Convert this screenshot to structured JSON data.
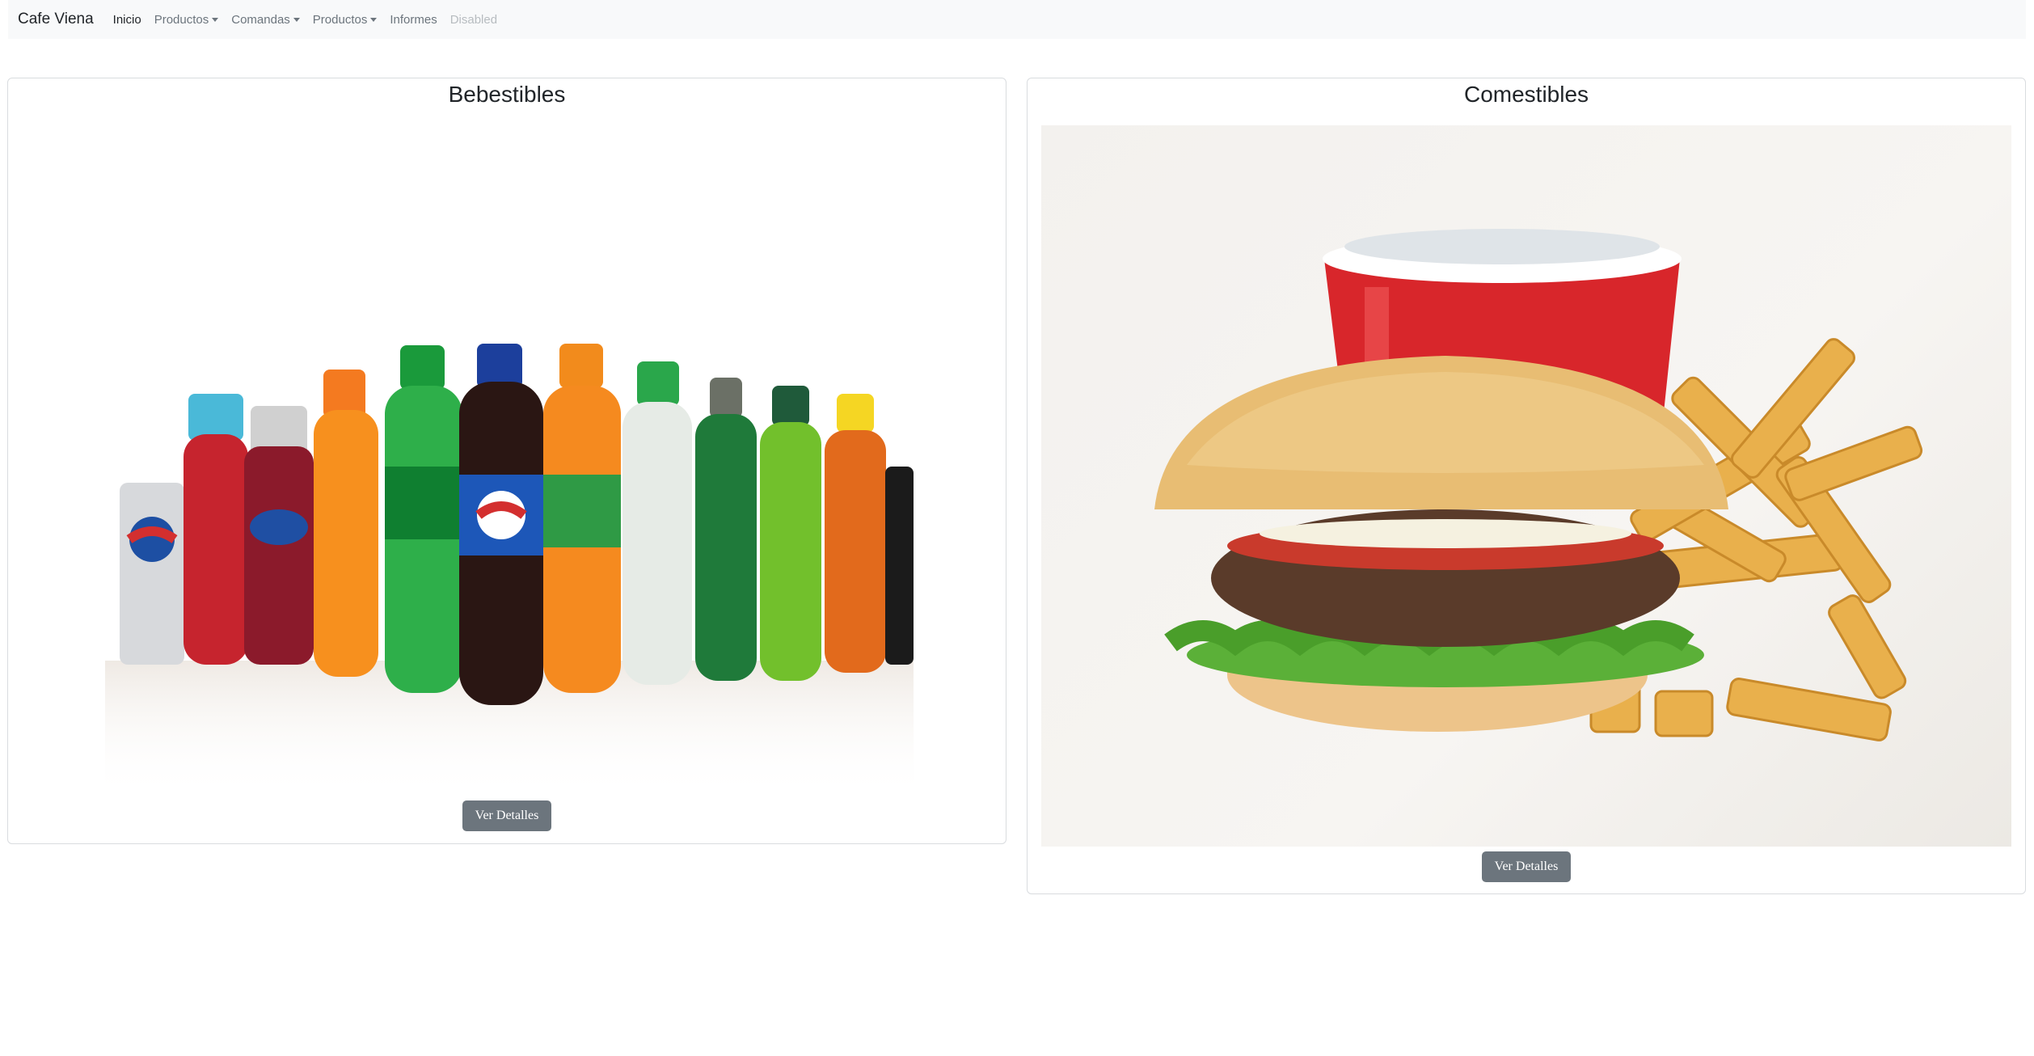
{
  "navbar": {
    "brand": "Cafe Viena",
    "items": [
      {
        "label": "Inicio",
        "dropdown": false,
        "state": "active"
      },
      {
        "label": "Productos",
        "dropdown": true,
        "state": "normal"
      },
      {
        "label": "Comandas",
        "dropdown": true,
        "state": "normal"
      },
      {
        "label": "Productos",
        "dropdown": true,
        "state": "normal"
      },
      {
        "label": "Informes",
        "dropdown": false,
        "state": "normal"
      },
      {
        "label": "Disabled",
        "dropdown": false,
        "state": "disabled"
      }
    ]
  },
  "cards": [
    {
      "title": "Bebestibles",
      "button_label": "Ver Detalles",
      "image": "soft-drink-bottles"
    },
    {
      "title": "Comestibles",
      "button_label": "Ver Detalles",
      "image": "burger-fries-soda"
    }
  ],
  "colors": {
    "navbar_bg": "#f8f9fa",
    "button_bg": "#6c757d",
    "card_border": "#d9dcdf"
  }
}
